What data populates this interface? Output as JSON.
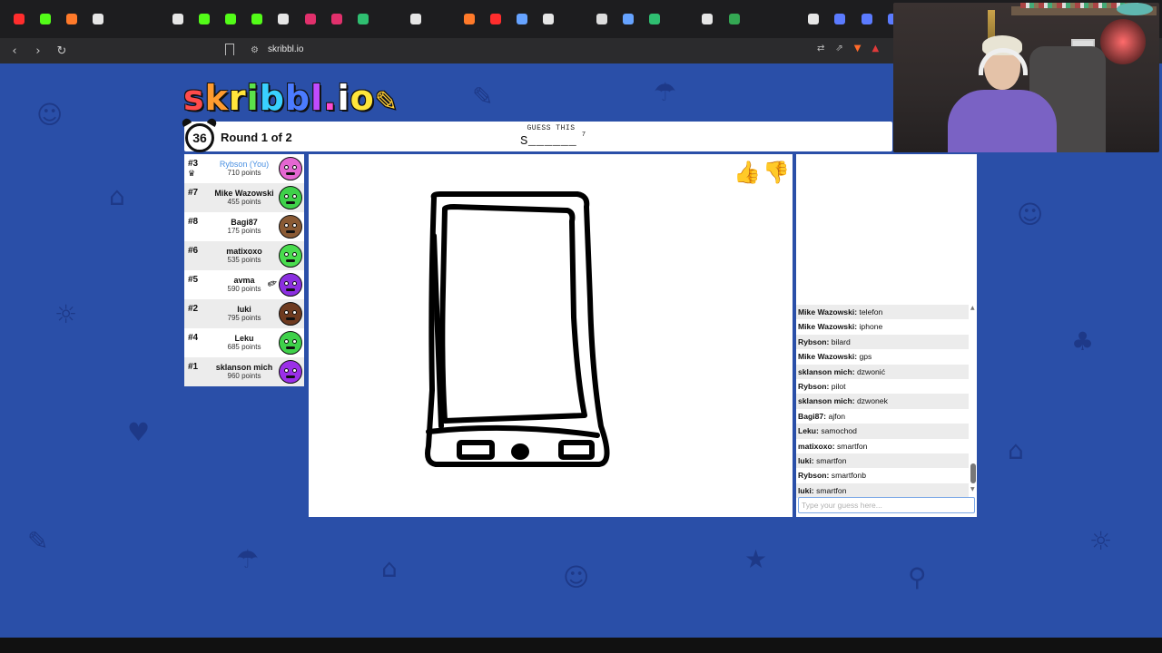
{
  "browser": {
    "url": "skribbl.io",
    "tabs": [
      {
        "icon": "youtube-icon",
        "color": "#ff2d2d"
      },
      {
        "icon": "kick-icon",
        "color": "#53fc18"
      },
      {
        "icon": "home-icon",
        "color": "#ff7a2a"
      },
      {
        "icon": "tiktok-icon",
        "color": "#e6e6e6"
      },
      {
        "icon": "google-icon",
        "color": "#ffffff"
      },
      {
        "icon": "google-icon",
        "color": "#ffffff"
      },
      {
        "icon": "tiktok-icon",
        "color": "#e6e6e6"
      },
      {
        "icon": "kick-icon",
        "color": "#53fc18"
      },
      {
        "icon": "kick-icon",
        "color": "#53fc18"
      },
      {
        "icon": "kick-icon",
        "color": "#53fc18"
      },
      {
        "icon": "x-icon",
        "color": "#e6e6e6"
      },
      {
        "icon": "instagram-icon",
        "color": "#e1306c"
      },
      {
        "icon": "instagram-icon",
        "color": "#e1306c"
      },
      {
        "icon": "sheets-icon",
        "color": "#2fbf71"
      },
      {
        "icon": "google-icon",
        "color": "#ffffff"
      },
      {
        "icon": "tiktok-icon",
        "color": "#e6e6e6"
      },
      {
        "icon": "google-icon",
        "color": "#ffffff"
      },
      {
        "icon": "home-icon",
        "color": "#ff7a2a"
      },
      {
        "icon": "youtube-icon",
        "color": "#ff2d2d"
      },
      {
        "icon": "steam-icon",
        "color": "#66a3ff"
      },
      {
        "icon": "tiktok-icon",
        "color": "#e6e6e6"
      },
      {
        "icon": "globe-icon",
        "color": "#bbbbbb"
      },
      {
        "icon": "stack-icon",
        "color": "#dddddd"
      },
      {
        "icon": "steam-icon",
        "color": "#66a3ff"
      },
      {
        "icon": "sheets-icon",
        "color": "#2fbf71"
      },
      {
        "icon": "google-icon",
        "color": "#ffffff"
      },
      {
        "icon": "x-icon",
        "color": "#e6e6e6"
      },
      {
        "icon": "maps-icon",
        "color": "#34a853"
      },
      {
        "icon": "google-icon",
        "color": "#ffffff"
      },
      {
        "icon": "google-icon",
        "color": "#ffffff"
      },
      {
        "icon": "tiktok-icon",
        "color": "#e6e6e6"
      },
      {
        "icon": "translate-icon",
        "color": "#5b7bff"
      },
      {
        "icon": "translate-icon",
        "color": "#5b7bff"
      },
      {
        "icon": "window-icon",
        "color": "#5b7bff"
      }
    ]
  },
  "game": {
    "logo_text": "skribbl.io",
    "timer": "36",
    "round_text": "Round 1 of 2",
    "guess_label": "GUESS THIS",
    "word_hint": "S______",
    "word_length": "7",
    "chat_placeholder": "Type your guess here..."
  },
  "players": [
    {
      "rank": "#3",
      "name": "Rybson (You)",
      "points": "710 points",
      "is_you": true,
      "crown": true,
      "avatar_color": "#e567d2"
    },
    {
      "rank": "#7",
      "name": "Mike Wazowski",
      "points": "455 points",
      "avatar_color": "#3fd14a"
    },
    {
      "rank": "#8",
      "name": "Bagi87",
      "points": "175 points",
      "avatar_color": "#8a5a34"
    },
    {
      "rank": "#6",
      "name": "matixoxo",
      "points": "535 points",
      "avatar_color": "#49dc4e"
    },
    {
      "rank": "#5",
      "name": "avma",
      "points": "590 points",
      "drawing": true,
      "avatar_color": "#8b2fe0"
    },
    {
      "rank": "#2",
      "name": "luki",
      "points": "795 points",
      "avatar_color": "#6e3a1f"
    },
    {
      "rank": "#4",
      "name": "Leku",
      "points": "685 points",
      "avatar_color": "#3fd14a"
    },
    {
      "rank": "#1",
      "name": "sklanson mich",
      "points": "960 points",
      "avatar_color": "#9b2fe8"
    }
  ],
  "chat": [
    {
      "user": "Mike Wazowski:",
      "text": "telefon"
    },
    {
      "user": "Mike Wazowski:",
      "text": "iphone"
    },
    {
      "user": "Rybson:",
      "text": "bilard"
    },
    {
      "user": "Mike Wazowski:",
      "text": "gps"
    },
    {
      "user": "sklanson mich:",
      "text": "dzwonić"
    },
    {
      "user": "Rybson:",
      "text": "pilot"
    },
    {
      "user": "sklanson mich:",
      "text": "dzwonek"
    },
    {
      "user": "Bagi87:",
      "text": "ajfon"
    },
    {
      "user": "Leku:",
      "text": "samochod"
    },
    {
      "user": "matixoxo:",
      "text": "smartfon"
    },
    {
      "user": "luki:",
      "text": "smartfon"
    },
    {
      "user": "Rybson:",
      "text": "smartfonb"
    },
    {
      "user": "luki:",
      "text": "smartfon"
    }
  ]
}
